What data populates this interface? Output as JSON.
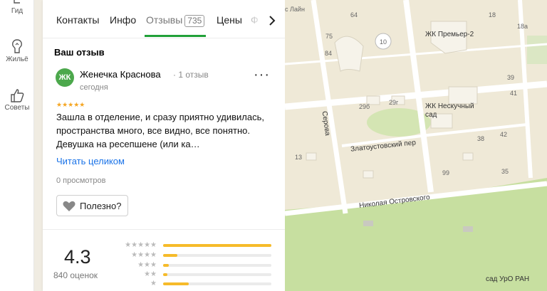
{
  "rail": {
    "items": [
      {
        "label": "Гид",
        "icon": "guide-icon"
      },
      {
        "label": "Жильё",
        "icon": "housing-icon"
      },
      {
        "label": "Советы",
        "icon": "thumbs-up-icon"
      }
    ]
  },
  "tabs": {
    "items": [
      {
        "label": "Контакты"
      },
      {
        "label": "Инфо"
      },
      {
        "label": "Отзывы",
        "count": "735"
      },
      {
        "label": "Цены"
      },
      {
        "label": "Ф"
      }
    ],
    "next_icon": "chevron-right-icon",
    "active_color": "#21a038"
  },
  "review": {
    "heading": "Ваш отзыв",
    "avatar_text": "ЖК",
    "author": "Женечка Краснова",
    "author_meta": "· 1 отзыв",
    "date": "сегодня",
    "rating": 5,
    "stars": "★★★★★",
    "text": "Зашла в отделение, и сразу приятно удивилась, пространства много, все видно, все понятно. Девушка на ресепшене (или ка…",
    "read_more": "Читать целиком",
    "views": "0 просмотров",
    "useful_label": "Полезно?",
    "menu_icon": "more-dots-icon"
  },
  "summary": {
    "rating": "4.3",
    "count": "840 оценок",
    "distribution": [
      {
        "stars": "★★★★★",
        "fraction": 1.0
      },
      {
        "stars": "★★★★",
        "fraction": 0.13
      },
      {
        "stars": "★★★",
        "fraction": 0.05
      },
      {
        "stars": "★★",
        "fraction": 0.04
      },
      {
        "stars": "★",
        "fraction": 0.24
      }
    ],
    "bar_color": "#f6bb2a"
  },
  "map": {
    "labels": {
      "top_street": "с Лайн",
      "n64": "64",
      "n18": "18",
      "n18a": "18а",
      "n75": "75",
      "n10": "10",
      "n84": "84",
      "premier": "ЖК Премьер-2",
      "n39": "39",
      "n41": "41",
      "neskuchny": "ЖК Нескучный сад",
      "n29b": "29б",
      "n29g": "29г",
      "n38": "38",
      "n42": "42",
      "n13": "13",
      "zlatoust": "Златоустовский пер",
      "serova": "Серова",
      "n99": "99",
      "n35": "35",
      "ostrovsky": "Николая Островского",
      "garden": "сад УрО РАН"
    }
  }
}
